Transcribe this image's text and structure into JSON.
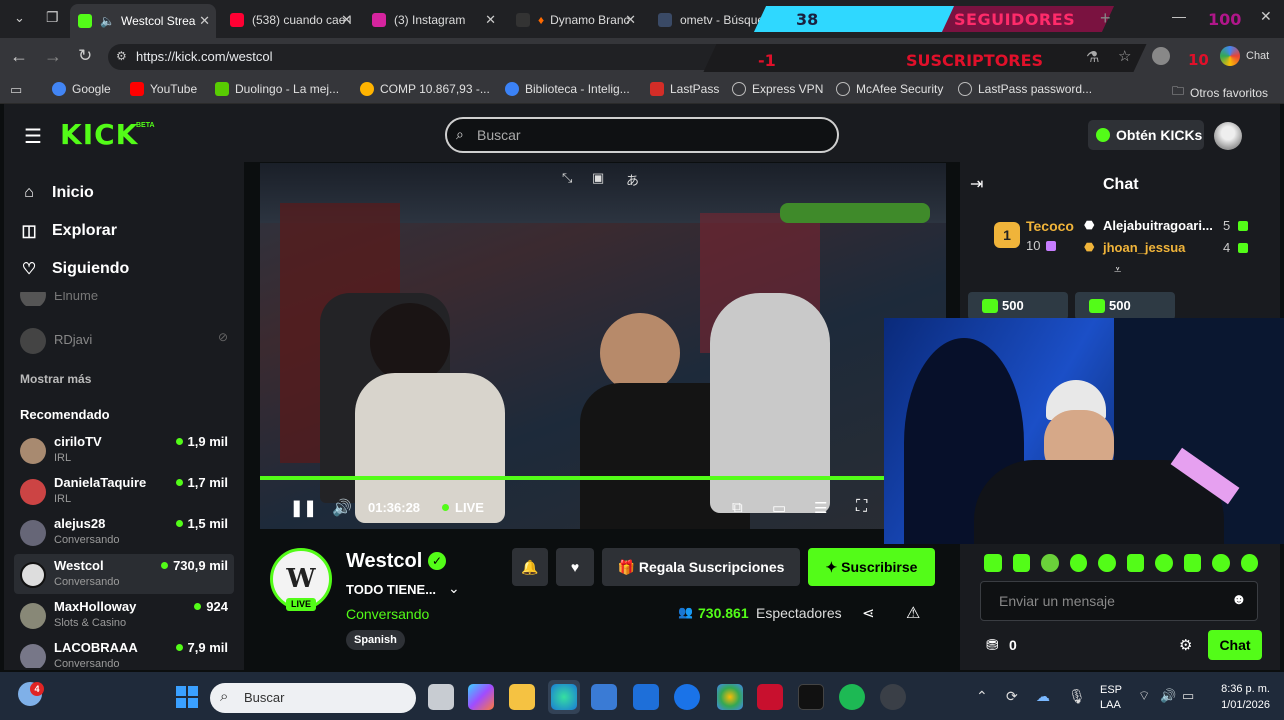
{
  "browser": {
    "tabs": [
      {
        "label": "Westcol Strea",
        "color": "#53fc18"
      },
      {
        "label": "(538) cuando cae l",
        "color": "#ff0033"
      },
      {
        "label": "(3) Instagram",
        "color": "#d6249f"
      },
      {
        "label": "Dynamo Branc",
        "color": "#ff6a00"
      },
      {
        "label": "ometv - Búsqueda",
        "color": "#4285f4"
      }
    ],
    "url": "https://kick.com/westcol",
    "profile_label": "Chat",
    "bookmarks": [
      {
        "label": "Google",
        "color": "#4285f4"
      },
      {
        "label": "YouTube",
        "color": "#ff0000"
      },
      {
        "label": "Duolingo - La mej...",
        "color": "#58cc02"
      },
      {
        "label": "COMP 10.867,93 -...",
        "color": "#ffb400"
      },
      {
        "label": "Biblioteca - Intelig...",
        "color": "#3b82f6"
      },
      {
        "label": "LastPass",
        "color": "#d32d27"
      },
      {
        "label": "Express VPN",
        "color": "#888888"
      },
      {
        "label": "McAfee Security",
        "color": "#888888"
      },
      {
        "label": "LastPass password...",
        "color": "#888888"
      }
    ],
    "other_favorites": "Otros favoritos"
  },
  "overlay": {
    "followers_count": "38",
    "followers_label": "SEGUIDORES",
    "followers_goal": "100",
    "subs_count": "-1",
    "subs_label": "SUSCRIPTORES",
    "subs_goal": "10"
  },
  "kick": {
    "logo": "KICK",
    "logo_badge": "BETA",
    "search_placeholder": "Buscar",
    "get_kicks": "Obtén KICKs",
    "nav": [
      {
        "label": "Inicio",
        "icon": "home-icon"
      },
      {
        "label": "Explorar",
        "icon": "compass-icon"
      },
      {
        "label": "Siguiendo",
        "icon": "heart-icon"
      }
    ],
    "following_partial": "Elnume",
    "following_offline": "RDjavi",
    "show_more": "Mostrar más",
    "recommended_title": "Recomendado",
    "recommended": [
      {
        "name": "ciriloTV",
        "category": "IRL",
        "viewers": "1,9 mil",
        "color": "#a88a70"
      },
      {
        "name": "DanielaTaquire",
        "category": "IRL",
        "viewers": "1,7 mil",
        "color": "#c44"
      },
      {
        "name": "alejus28",
        "category": "Conversando",
        "viewers": "1,5 mil",
        "color": "#667"
      },
      {
        "name": "Westcol",
        "category": "Conversando",
        "viewers": "730,9 mil",
        "color": "#ddd"
      },
      {
        "name": "MaxHolloway",
        "category": "Slots & Casino",
        "viewers": "924",
        "color": "#887"
      },
      {
        "name": "LACOBRAAA",
        "category": "Conversando",
        "viewers": "7,9 mil",
        "color": "#778"
      }
    ],
    "player": {
      "time": "01:36:28",
      "live": "LIVE",
      "progress": 1.0
    },
    "streamer": {
      "name": "Westcol",
      "title": "TODO TIENE...",
      "category": "Conversando",
      "language": "Spanish",
      "live_badge": "LIVE",
      "viewers": "730.861",
      "viewers_label": "Espectadores"
    },
    "actions": {
      "gift": "Regala Suscripciones",
      "subscribe": "Suscribirse"
    },
    "chat": {
      "title": "Chat",
      "top_gifter_name": "Tecoco",
      "top_gifter_count": "10",
      "rank_badge": "1",
      "gifters": [
        {
          "name": "Alejabuitragoari...",
          "count": "5",
          "color": "#ffffff"
        },
        {
          "name": "jhoan_jessua",
          "count": "4",
          "color": "#f0b43a"
        }
      ],
      "pinned": [
        "500",
        "500"
      ],
      "input_placeholder": "Enviar un mensaje",
      "kicks_balance": "0",
      "send": "Chat"
    }
  },
  "taskbar": {
    "search": "Buscar",
    "notification_badge": "4",
    "lang_top": "ESP",
    "lang_bottom": "LAA",
    "time": "8:36 p. m.",
    "date": "1/01/2026"
  }
}
